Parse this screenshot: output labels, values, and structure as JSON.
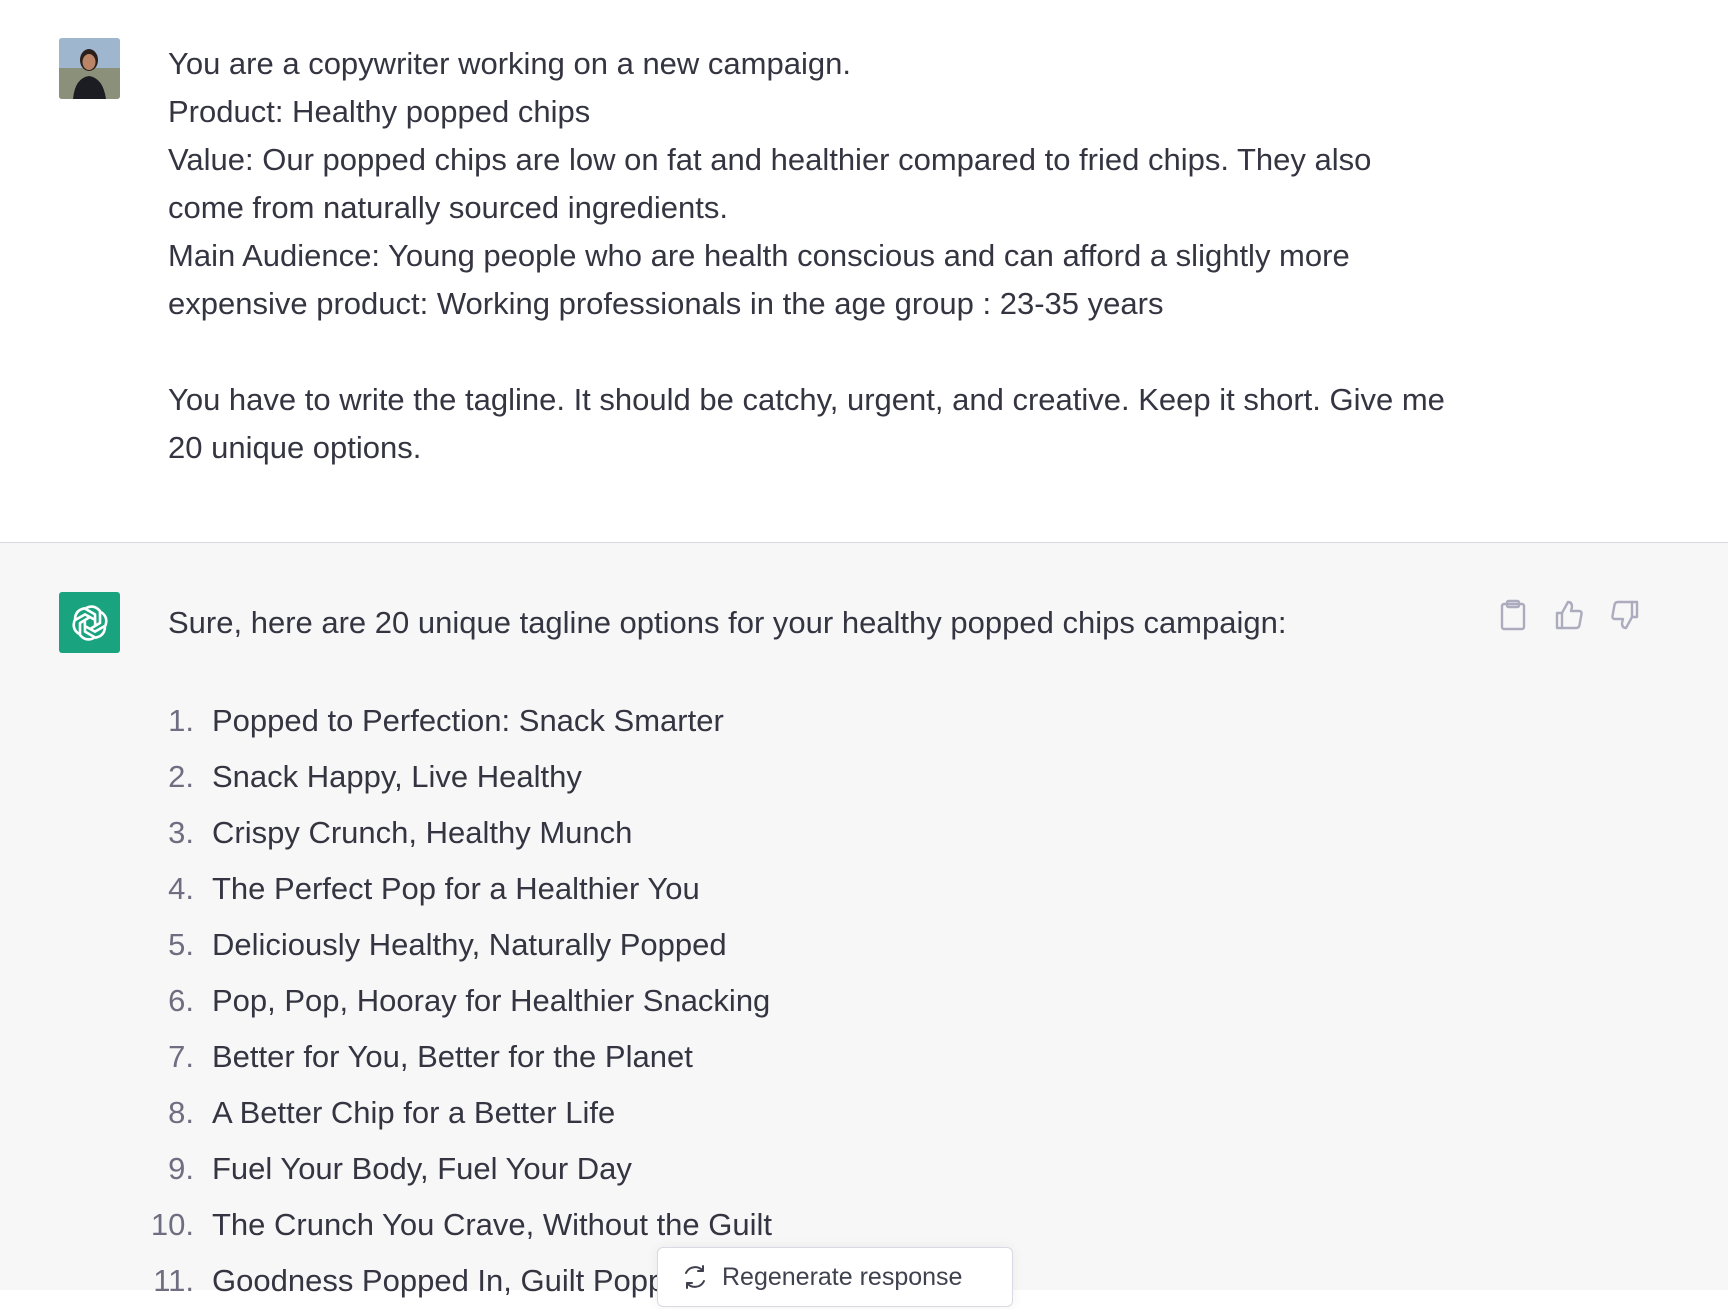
{
  "user_message": {
    "avatar_label": "user-avatar",
    "lines": [
      "You are a copywriter working on a new campaign.",
      "Product: Healthy popped chips",
      "Value: Our popped chips are low on fat and healthier compared to fried chips. They also",
      "come from naturally sourced ingredients.",
      "Main Audience: Young people who are health conscious and can afford a slightly more",
      "expensive product: Working professionals in the age group : 23-35 years"
    ],
    "request_lines": [
      "You have to write the tagline. It should be catchy, urgent, and creative. Keep it short. Give me",
      "20 unique options."
    ]
  },
  "assistant_message": {
    "intro": "Sure, here are 20 unique tagline options for your healthy popped chips campaign:",
    "taglines": [
      {
        "num": "1.",
        "text": "Popped to Perfection: Snack Smarter"
      },
      {
        "num": "2.",
        "text": "Snack Happy, Live Healthy"
      },
      {
        "num": "3.",
        "text": "Crispy Crunch, Healthy Munch"
      },
      {
        "num": "4.",
        "text": "The Perfect Pop for a Healthier You"
      },
      {
        "num": "5.",
        "text": "Deliciously Healthy, Naturally Popped"
      },
      {
        "num": "6.",
        "text": "Pop, Pop, Hooray for Healthier Snacking"
      },
      {
        "num": "7.",
        "text": "Better for You, Better for the Planet"
      },
      {
        "num": "8.",
        "text": "A Better Chip for a Better Life"
      },
      {
        "num": "9.",
        "text": "Fuel Your Body, Fuel Your Day"
      },
      {
        "num": "10.",
        "text": "The Crunch You Crave, Without the Guilt"
      },
      {
        "num": "11.",
        "text": "Goodness Popped In, Guilt Popped Out"
      }
    ],
    "actions": {
      "copy_icon": "clipboard-icon",
      "like_icon": "thumbs-up-icon",
      "dislike_icon": "thumbs-down-icon"
    }
  },
  "regenerate": {
    "label": "Regenerate response",
    "icon": "refresh-icon"
  },
  "colors": {
    "assistant_bg": "#f7f7f8",
    "logo_bg": "#19a37f",
    "text": "#343541"
  }
}
